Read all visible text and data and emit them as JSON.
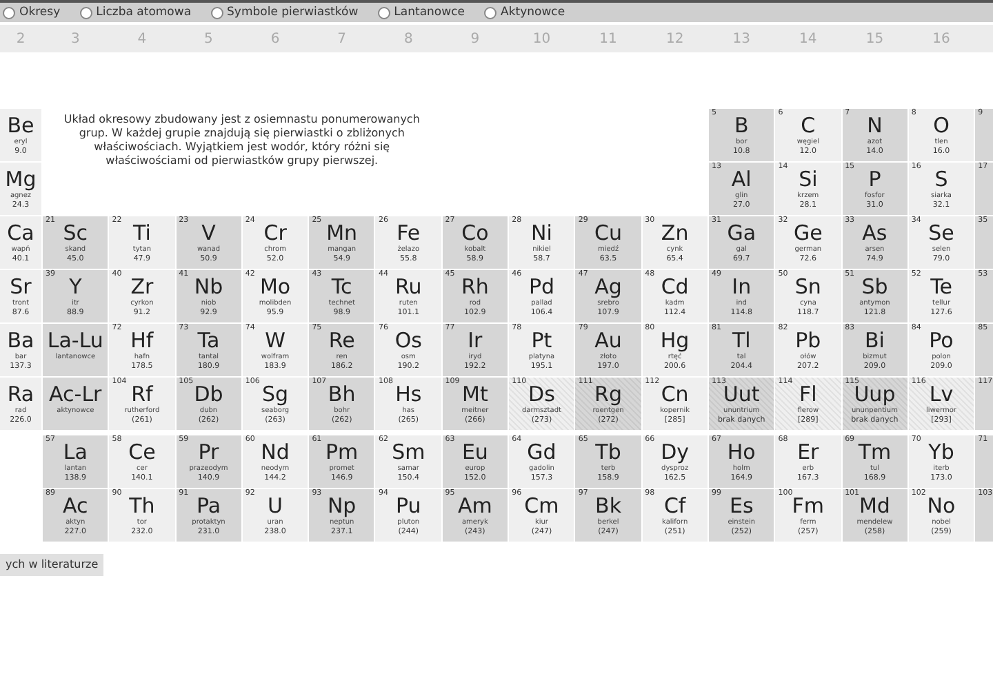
{
  "radio_options": [
    {
      "label": "Okresy",
      "selected": false
    },
    {
      "label": "Liczba atomowa",
      "selected": false
    },
    {
      "label": "Symbole pierwiastków",
      "selected": false
    },
    {
      "label": "Lantanowce",
      "selected": false
    },
    {
      "label": "Aktynowce",
      "selected": false
    }
  ],
  "group_headers": [
    "2",
    "3",
    "4",
    "5",
    "6",
    "7",
    "8",
    "9",
    "10",
    "11",
    "12",
    "13",
    "14",
    "15",
    "16"
  ],
  "description": "Układ okresowy zbudowany jest z osiemnastu ponumerowanych grup. W każdej grupie znajdują się pierwiastki o zbliżonych właściwościach. Wyjątkiem jest wodór, który różni się właściwościami od pierwiastków grupy pierwszej.",
  "periods": [
    {
      "cells": [
        {
          "kind": "element",
          "symbol": "Be",
          "name": "eryl",
          "mass": "9.0"
        },
        {
          "kind": "empty"
        },
        {
          "kind": "empty"
        },
        {
          "kind": "empty"
        },
        {
          "kind": "empty"
        },
        {
          "kind": "empty"
        },
        {
          "kind": "empty"
        },
        {
          "kind": "empty"
        },
        {
          "kind": "empty"
        },
        {
          "kind": "empty"
        },
        {
          "kind": "empty"
        },
        {
          "kind": "element",
          "number": "5",
          "symbol": "B",
          "name": "bor",
          "mass": "10.8"
        },
        {
          "kind": "element",
          "number": "6",
          "symbol": "C",
          "name": "węgiel",
          "mass": "12.0"
        },
        {
          "kind": "element",
          "number": "7",
          "symbol": "N",
          "name": "azot",
          "mass": "14.0"
        },
        {
          "kind": "element",
          "number": "8",
          "symbol": "O",
          "name": "tlen",
          "mass": "16.0"
        },
        {
          "kind": "element",
          "number": "9"
        }
      ]
    },
    {
      "cells": [
        {
          "kind": "element",
          "symbol": "Mg",
          "name": "agnez",
          "mass": "24.3"
        },
        {
          "kind": "empty"
        },
        {
          "kind": "empty"
        },
        {
          "kind": "empty"
        },
        {
          "kind": "empty"
        },
        {
          "kind": "empty"
        },
        {
          "kind": "empty"
        },
        {
          "kind": "empty"
        },
        {
          "kind": "empty"
        },
        {
          "kind": "empty"
        },
        {
          "kind": "empty"
        },
        {
          "kind": "element",
          "number": "13",
          "symbol": "Al",
          "name": "glin",
          "mass": "27.0"
        },
        {
          "kind": "element",
          "number": "14",
          "symbol": "Si",
          "name": "krzem",
          "mass": "28.1"
        },
        {
          "kind": "element",
          "number": "15",
          "symbol": "P",
          "name": "fosfor",
          "mass": "31.0"
        },
        {
          "kind": "element",
          "number": "16",
          "symbol": "S",
          "name": "siarka",
          "mass": "32.1"
        },
        {
          "kind": "element",
          "number": "17"
        }
      ]
    },
    {
      "cells": [
        {
          "kind": "element",
          "symbol": "Ca",
          "name": "wapń",
          "mass": "40.1"
        },
        {
          "kind": "element",
          "number": "21",
          "symbol": "Sc",
          "name": "skand",
          "mass": "45.0"
        },
        {
          "kind": "element",
          "number": "22",
          "symbol": "Ti",
          "name": "tytan",
          "mass": "47.9"
        },
        {
          "kind": "element",
          "number": "23",
          "symbol": "V",
          "name": "wanad",
          "mass": "50.9"
        },
        {
          "kind": "element",
          "number": "24",
          "symbol": "Cr",
          "name": "chrom",
          "mass": "52.0"
        },
        {
          "kind": "element",
          "number": "25",
          "symbol": "Mn",
          "name": "mangan",
          "mass": "54.9"
        },
        {
          "kind": "element",
          "number": "26",
          "symbol": "Fe",
          "name": "żelazo",
          "mass": "55.8"
        },
        {
          "kind": "element",
          "number": "27",
          "symbol": "Co",
          "name": "kobalt",
          "mass": "58.9"
        },
        {
          "kind": "element",
          "number": "28",
          "symbol": "Ni",
          "name": "nikiel",
          "mass": "58.7"
        },
        {
          "kind": "element",
          "number": "29",
          "symbol": "Cu",
          "name": "miedź",
          "mass": "63.5"
        },
        {
          "kind": "element",
          "number": "30",
          "symbol": "Zn",
          "name": "cynk",
          "mass": "65.4"
        },
        {
          "kind": "element",
          "number": "31",
          "symbol": "Ga",
          "name": "gal",
          "mass": "69.7"
        },
        {
          "kind": "element",
          "number": "32",
          "symbol": "Ge",
          "name": "german",
          "mass": "72.6"
        },
        {
          "kind": "element",
          "number": "33",
          "symbol": "As",
          "name": "arsen",
          "mass": "74.9"
        },
        {
          "kind": "element",
          "number": "34",
          "symbol": "Se",
          "name": "selen",
          "mass": "79.0"
        },
        {
          "kind": "element",
          "number": "35"
        }
      ]
    },
    {
      "cells": [
        {
          "kind": "element",
          "symbol": "Sr",
          "name": "tront",
          "mass": "87.6"
        },
        {
          "kind": "element",
          "number": "39",
          "symbol": "Y",
          "name": "itr",
          "mass": "88.9"
        },
        {
          "kind": "element",
          "number": "40",
          "symbol": "Zr",
          "name": "cyrkon",
          "mass": "91.2"
        },
        {
          "kind": "element",
          "number": "41",
          "symbol": "Nb",
          "name": "niob",
          "mass": "92.9"
        },
        {
          "kind": "element",
          "number": "42",
          "symbol": "Mo",
          "name": "molibden",
          "mass": "95.9"
        },
        {
          "kind": "element",
          "number": "43",
          "symbol": "Tc",
          "name": "technet",
          "mass": "98.9"
        },
        {
          "kind": "element",
          "number": "44",
          "symbol": "Ru",
          "name": "ruten",
          "mass": "101.1"
        },
        {
          "kind": "element",
          "number": "45",
          "symbol": "Rh",
          "name": "rod",
          "mass": "102.9"
        },
        {
          "kind": "element",
          "number": "46",
          "symbol": "Pd",
          "name": "pallad",
          "mass": "106.4"
        },
        {
          "kind": "element",
          "number": "47",
          "symbol": "Ag",
          "name": "srebro",
          "mass": "107.9"
        },
        {
          "kind": "element",
          "number": "48",
          "symbol": "Cd",
          "name": "kadm",
          "mass": "112.4"
        },
        {
          "kind": "element",
          "number": "49",
          "symbol": "In",
          "name": "ind",
          "mass": "114.8"
        },
        {
          "kind": "element",
          "number": "50",
          "symbol": "Sn",
          "name": "cyna",
          "mass": "118.7"
        },
        {
          "kind": "element",
          "number": "51",
          "symbol": "Sb",
          "name": "antymon",
          "mass": "121.8"
        },
        {
          "kind": "element",
          "number": "52",
          "symbol": "Te",
          "name": "tellur",
          "mass": "127.6"
        },
        {
          "kind": "element",
          "number": "53"
        }
      ]
    },
    {
      "cells": [
        {
          "kind": "element",
          "symbol": "Ba",
          "name": "bar",
          "mass": "137.3"
        },
        {
          "kind": "element",
          "symbol": "La-Lu",
          "name": "lantanowce"
        },
        {
          "kind": "element",
          "number": "72",
          "symbol": "Hf",
          "name": "hafn",
          "mass": "178.5"
        },
        {
          "kind": "element",
          "number": "73",
          "symbol": "Ta",
          "name": "tantal",
          "mass": "180.9"
        },
        {
          "kind": "element",
          "number": "74",
          "symbol": "W",
          "name": "wolfram",
          "mass": "183.9"
        },
        {
          "kind": "element",
          "number": "75",
          "symbol": "Re",
          "name": "ren",
          "mass": "186.2"
        },
        {
          "kind": "element",
          "number": "76",
          "symbol": "Os",
          "name": "osm",
          "mass": "190.2"
        },
        {
          "kind": "element",
          "number": "77",
          "symbol": "Ir",
          "name": "iryd",
          "mass": "192.2"
        },
        {
          "kind": "element",
          "number": "78",
          "symbol": "Pt",
          "name": "platyna",
          "mass": "195.1"
        },
        {
          "kind": "element",
          "number": "79",
          "symbol": "Au",
          "name": "złoto",
          "mass": "197.0"
        },
        {
          "kind": "element",
          "number": "80",
          "symbol": "Hg",
          "name": "rtęć",
          "mass": "200.6"
        },
        {
          "kind": "element",
          "number": "81",
          "symbol": "Tl",
          "name": "tal",
          "mass": "204.4"
        },
        {
          "kind": "element",
          "number": "82",
          "symbol": "Pb",
          "name": "ołów",
          "mass": "207.2"
        },
        {
          "kind": "element",
          "number": "83",
          "symbol": "Bi",
          "name": "bizmut",
          "mass": "209.0"
        },
        {
          "kind": "element",
          "number": "84",
          "symbol": "Po",
          "name": "polon",
          "mass": "209.0"
        },
        {
          "kind": "element",
          "number": "85"
        }
      ]
    },
    {
      "cells": [
        {
          "kind": "element",
          "symbol": "Ra",
          "name": "rad",
          "mass": "226.0"
        },
        {
          "kind": "element",
          "symbol": "Ac-Lr",
          "name": "aktynowce"
        },
        {
          "kind": "element",
          "number": "104",
          "symbol": "Rf",
          "name": "rutherford",
          "mass": "(261)"
        },
        {
          "kind": "element",
          "number": "105",
          "symbol": "Db",
          "name": "dubn",
          "mass": "(262)"
        },
        {
          "kind": "element",
          "number": "106",
          "symbol": "Sg",
          "name": "seaborg",
          "mass": "(263)"
        },
        {
          "kind": "element",
          "number": "107",
          "symbol": "Bh",
          "name": "bohr",
          "mass": "(262)"
        },
        {
          "kind": "element",
          "number": "108",
          "symbol": "Hs",
          "name": "has",
          "mass": "(265)"
        },
        {
          "kind": "element",
          "number": "109",
          "symbol": "Mt",
          "name": "meitner",
          "mass": "(266)"
        },
        {
          "kind": "element",
          "number": "110",
          "symbol": "Ds",
          "name": "darmsztadt",
          "mass": "(273)",
          "hatched": true
        },
        {
          "kind": "element",
          "number": "111",
          "symbol": "Rg",
          "name": "roentgen",
          "mass": "(272)",
          "hatched": true
        },
        {
          "kind": "element",
          "number": "112",
          "symbol": "Cn",
          "name": "kopernik",
          "mass": "[285]"
        },
        {
          "kind": "element",
          "number": "113",
          "symbol": "Uut",
          "name": "ununtrium",
          "mass": "brak danych",
          "hatched": true
        },
        {
          "kind": "element",
          "number": "114",
          "symbol": "Fl",
          "name": "flerow",
          "mass": "[289]",
          "hatched": true
        },
        {
          "kind": "element",
          "number": "115",
          "symbol": "Uup",
          "name": "ununpentium",
          "mass": "brak danych",
          "hatched": true
        },
        {
          "kind": "element",
          "number": "116",
          "symbol": "Lv",
          "name": "liwermor",
          "mass": "[293]",
          "hatched": true
        },
        {
          "kind": "element",
          "number": "117"
        }
      ]
    }
  ],
  "series": [
    {
      "cells": [
        {
          "kind": "empty"
        },
        {
          "kind": "element",
          "number": "57",
          "symbol": "La",
          "name": "lantan",
          "mass": "138.9"
        },
        {
          "kind": "element",
          "number": "58",
          "symbol": "Ce",
          "name": "cer",
          "mass": "140.1"
        },
        {
          "kind": "element",
          "number": "59",
          "symbol": "Pr",
          "name": "prazeodym",
          "mass": "140.9"
        },
        {
          "kind": "element",
          "number": "60",
          "symbol": "Nd",
          "name": "neodym",
          "mass": "144.2"
        },
        {
          "kind": "element",
          "number": "61",
          "symbol": "Pm",
          "name": "promet",
          "mass": "146.9"
        },
        {
          "kind": "element",
          "number": "62",
          "symbol": "Sm",
          "name": "samar",
          "mass": "150.4"
        },
        {
          "kind": "element",
          "number": "63",
          "symbol": "Eu",
          "name": "europ",
          "mass": "152.0"
        },
        {
          "kind": "element",
          "number": "64",
          "symbol": "Gd",
          "name": "gadolin",
          "mass": "157.3"
        },
        {
          "kind": "element",
          "number": "65",
          "symbol": "Tb",
          "name": "terb",
          "mass": "158.9"
        },
        {
          "kind": "element",
          "number": "66",
          "symbol": "Dy",
          "name": "dysproz",
          "mass": "162.5"
        },
        {
          "kind": "element",
          "number": "67",
          "symbol": "Ho",
          "name": "holm",
          "mass": "164.9"
        },
        {
          "kind": "element",
          "number": "68",
          "symbol": "Er",
          "name": "erb",
          "mass": "167.3"
        },
        {
          "kind": "element",
          "number": "69",
          "symbol": "Tm",
          "name": "tul",
          "mass": "168.9"
        },
        {
          "kind": "element",
          "number": "70",
          "symbol": "Yb",
          "name": "iterb",
          "mass": "173.0"
        },
        {
          "kind": "element",
          "number": "71"
        }
      ]
    },
    {
      "cells": [
        {
          "kind": "empty"
        },
        {
          "kind": "element",
          "number": "89",
          "symbol": "Ac",
          "name": "aktyn",
          "mass": "227.0"
        },
        {
          "kind": "element",
          "number": "90",
          "symbol": "Th",
          "name": "tor",
          "mass": "232.0"
        },
        {
          "kind": "element",
          "number": "91",
          "symbol": "Pa",
          "name": "protaktyn",
          "mass": "231.0"
        },
        {
          "kind": "element",
          "number": "92",
          "symbol": "U",
          "name": "uran",
          "mass": "238.0"
        },
        {
          "kind": "element",
          "number": "93",
          "symbol": "Np",
          "name": "neptun",
          "mass": "237.1"
        },
        {
          "kind": "element",
          "number": "94",
          "symbol": "Pu",
          "name": "pluton",
          "mass": "(244)"
        },
        {
          "kind": "element",
          "number": "95",
          "symbol": "Am",
          "name": "ameryk",
          "mass": "(243)"
        },
        {
          "kind": "element",
          "number": "96",
          "symbol": "Cm",
          "name": "kiur",
          "mass": "(247)"
        },
        {
          "kind": "element",
          "number": "97",
          "symbol": "Bk",
          "name": "berkel",
          "mass": "(247)"
        },
        {
          "kind": "element",
          "number": "98",
          "symbol": "Cf",
          "name": "kaliforn",
          "mass": "(251)"
        },
        {
          "kind": "element",
          "number": "99",
          "symbol": "Es",
          "name": "einstein",
          "mass": "(252)"
        },
        {
          "kind": "element",
          "number": "100",
          "symbol": "Fm",
          "name": "ferm",
          "mass": "(257)"
        },
        {
          "kind": "element",
          "number": "101",
          "symbol": "Md",
          "name": "mendelew",
          "mass": "(258)"
        },
        {
          "kind": "element",
          "number": "102",
          "symbol": "No",
          "name": "nobel",
          "mass": "(259)"
        },
        {
          "kind": "element",
          "number": "103"
        }
      ]
    }
  ],
  "footer_button": "ych w literaturze"
}
